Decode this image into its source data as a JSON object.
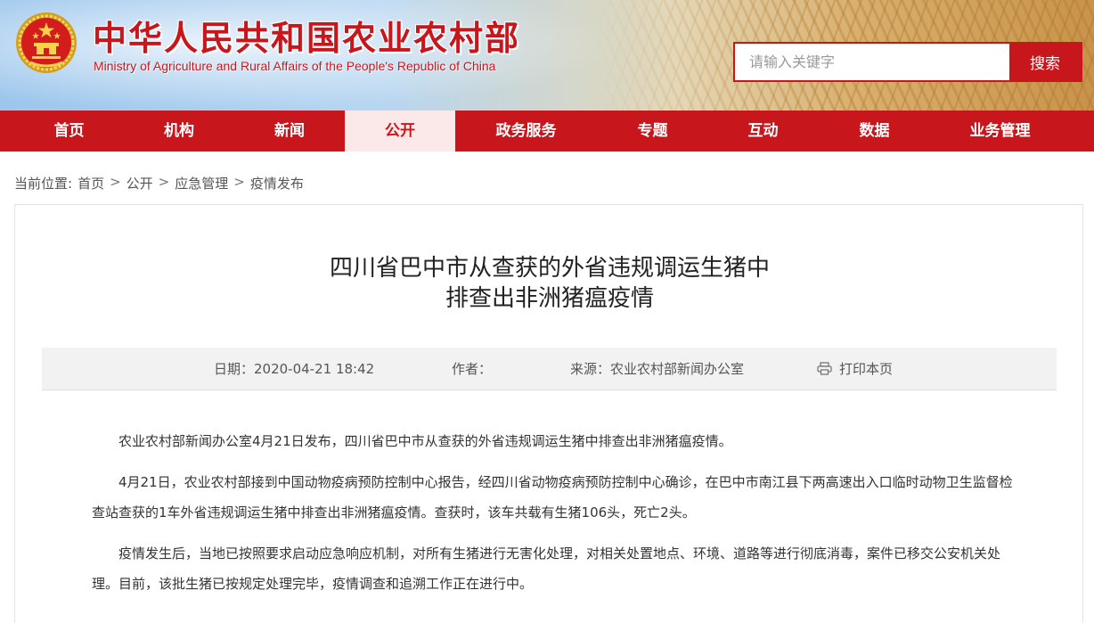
{
  "header": {
    "title": "中华人民共和国农业农村部",
    "subtitle": "Ministry of Agriculture  and  Rural  Affairs  of the People's Republic of China",
    "search_placeholder": "请输入关键字",
    "search_button": "搜索",
    "emblem_icon": "national-emblem-icon"
  },
  "nav": {
    "items": [
      {
        "label": "首页"
      },
      {
        "label": "机构"
      },
      {
        "label": "新闻"
      },
      {
        "label": "公开",
        "active": true
      },
      {
        "label": "政务服务"
      },
      {
        "label": "专题"
      },
      {
        "label": "互动"
      },
      {
        "label": "数据"
      },
      {
        "label": "业务管理"
      }
    ]
  },
  "breadcrumb": {
    "prefix": "当前位置:",
    "items": [
      "首页",
      "公开",
      "应急管理",
      "疫情发布"
    ],
    "separator": ">"
  },
  "article": {
    "title_line1": "四川省巴中市从查获的外省违规调运生猪中",
    "title_line2": "排查出非洲猪瘟疫情",
    "meta": {
      "date": "日期：2020-04-21 18:42",
      "author": "作者：",
      "source": "来源：农业农村部新闻办公室",
      "print": "打印本页",
      "print_icon": "printer-icon"
    },
    "paragraphs": [
      "农业农村部新闻办公室4月21日发布，四川省巴中市从查获的外省违规调运生猪中排查出非洲猪瘟疫情。",
      "4月21日，农业农村部接到中国动物疫病预防控制中心报告，经四川省动物疫病预防控制中心确诊，在巴中市南江县下两高速出入口临时动物卫生监督检查站查获的1车外省违规调运生猪中排查出非洲猪瘟疫情。查获时，该车共载有生猪106头，死亡2头。",
      "疫情发生后，当地已按照要求启动应急响应机制，对所有生猪进行无害化处理，对相关处置地点、环境、道路等进行彻底消毒，案件已移交公安机关处理。目前，该批生猪已按规定处理完毕，疫情调查和追溯工作正在进行中。"
    ]
  },
  "colors": {
    "brand_red": "#c8161d",
    "active_tab_bg": "#fbe9e9",
    "meta_bar_bg": "#f2f2f2"
  }
}
